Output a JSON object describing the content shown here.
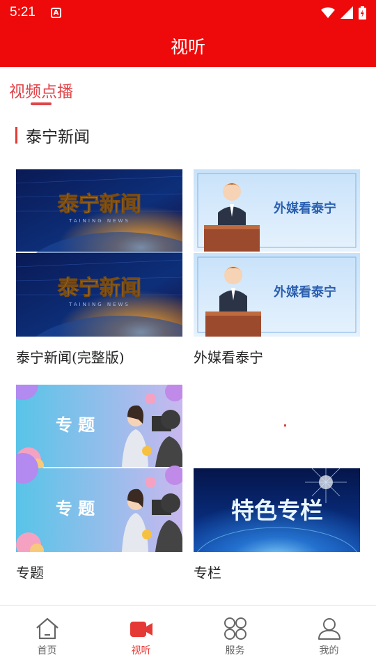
{
  "status_bar": {
    "time": "5:21",
    "notification_letter": "A"
  },
  "header": {
    "title": "视听"
  },
  "sub_tab": {
    "label": "视频点播"
  },
  "section": {
    "title": "泰宁新闻"
  },
  "cards": [
    {
      "label": "泰宁新闻(完整版)",
      "thumb_text": "泰宁新闻",
      "thumb_subtext": "TAINING NEWS"
    },
    {
      "label": "外媒看泰宁",
      "thumb_text": "外媒看泰宁"
    },
    {
      "label": "专题",
      "thumb_text": "专  题"
    },
    {
      "label": "专栏",
      "thumb_text": "特色专栏"
    }
  ],
  "bottom_nav": [
    {
      "label": "首页",
      "icon": "home-icon",
      "active": false
    },
    {
      "label": "视听",
      "icon": "video-camera-icon",
      "active": true
    },
    {
      "label": "服务",
      "icon": "grid-icon",
      "active": false
    },
    {
      "label": "我的",
      "icon": "user-icon",
      "active": false
    }
  ],
  "colors": {
    "brand_red": "#ee0a0a",
    "accent": "#e53935",
    "tab_red": "#e0454a"
  }
}
